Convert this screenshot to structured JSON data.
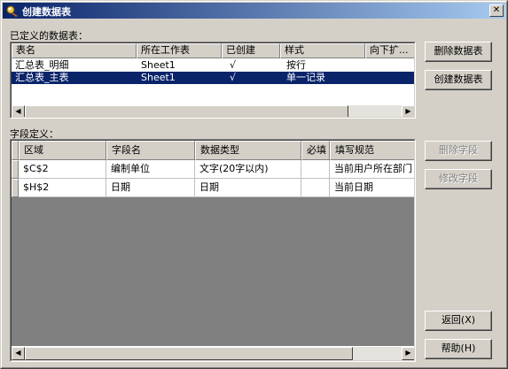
{
  "window": {
    "title": "创建数据表",
    "close_glyph": "✕"
  },
  "defined_tables": {
    "label": "已定义的数据表：",
    "columns": [
      "表名",
      "所在工作表",
      "已创建",
      "样式",
      "向下扩..."
    ],
    "rows": [
      {
        "name": "汇总表_明细",
        "sheet": "Sheet1",
        "created": "√",
        "style": "按行",
        "expand": "",
        "selected": false
      },
      {
        "name": "汇总表_主表",
        "sheet": "Sheet1",
        "created": "√",
        "style": "单一记录",
        "expand": "",
        "selected": true
      }
    ]
  },
  "field_defs": {
    "label": "字段定义：",
    "columns": [
      "区域",
      "字段名",
      "数据类型",
      "必填",
      "填写规范"
    ],
    "rows": [
      {
        "area": "$C$2",
        "field": "编制单位",
        "type": "文字(20字以内)",
        "required": "",
        "rule": "当前用户所在部门"
      },
      {
        "area": "$H$2",
        "field": "日期",
        "type": "日期",
        "required": "",
        "rule": "当前日期"
      }
    ]
  },
  "buttons": {
    "delete_table": "删除数据表",
    "create_table": "创建数据表",
    "delete_field": "删除字段",
    "modify_field": "修改字段",
    "back": "返回(X)",
    "help": "帮助(H)"
  },
  "scroll": {
    "left": "◀",
    "right": "▶"
  }
}
